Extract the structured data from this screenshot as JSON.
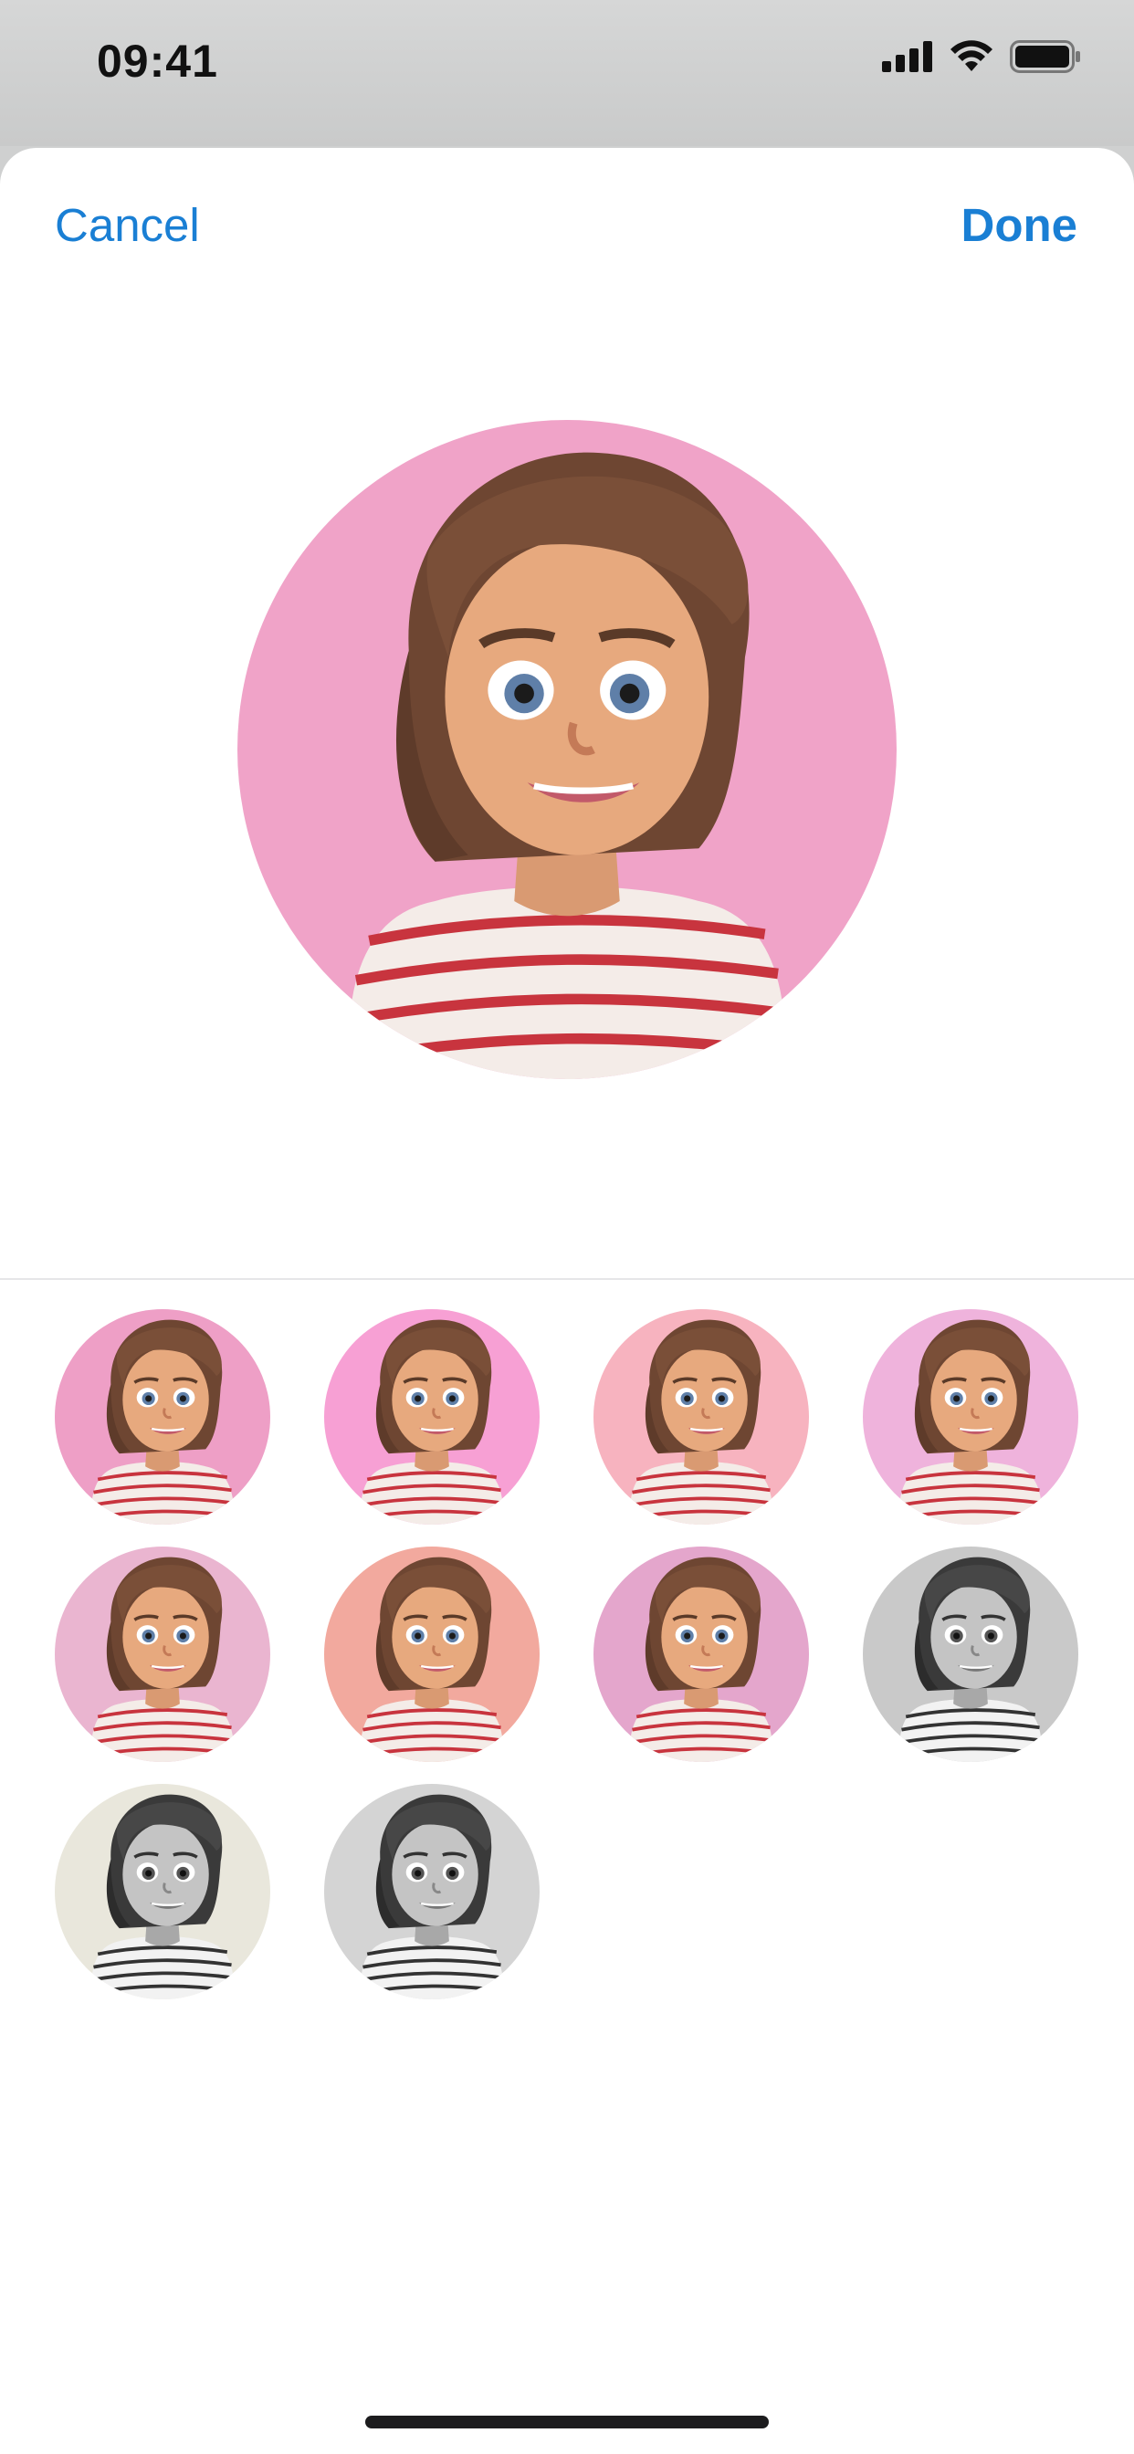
{
  "status_bar": {
    "time": "09:41",
    "icons": [
      "cellular-signal-icon",
      "wifi-icon",
      "battery-icon"
    ]
  },
  "nav": {
    "cancel_label": "Cancel",
    "done_label": "Done",
    "accent_color": "#1a7fd4"
  },
  "preview": {
    "style": "pink",
    "background": "#f0a3c8"
  },
  "styles": [
    {
      "id": "pink-1",
      "bg": "#ee9fc6",
      "mono": false
    },
    {
      "id": "pink-2",
      "bg": "#f7a0d4",
      "mono": false
    },
    {
      "id": "peach",
      "bg": "#f7b3bf",
      "mono": false
    },
    {
      "id": "lavender",
      "bg": "#efb3dc",
      "mono": false
    },
    {
      "id": "light-pink",
      "bg": "#eab5d0",
      "mono": false
    },
    {
      "id": "salmon",
      "bg": "#f2a99e",
      "mono": false
    },
    {
      "id": "mauve",
      "bg": "#e4a6cc",
      "mono": false
    },
    {
      "id": "gray",
      "bg": "#c9c9c9",
      "mono": true
    },
    {
      "id": "cream",
      "bg": "#e9e7dc",
      "mono": true
    },
    {
      "id": "light-gray",
      "bg": "#d4d4d4",
      "mono": true
    }
  ]
}
